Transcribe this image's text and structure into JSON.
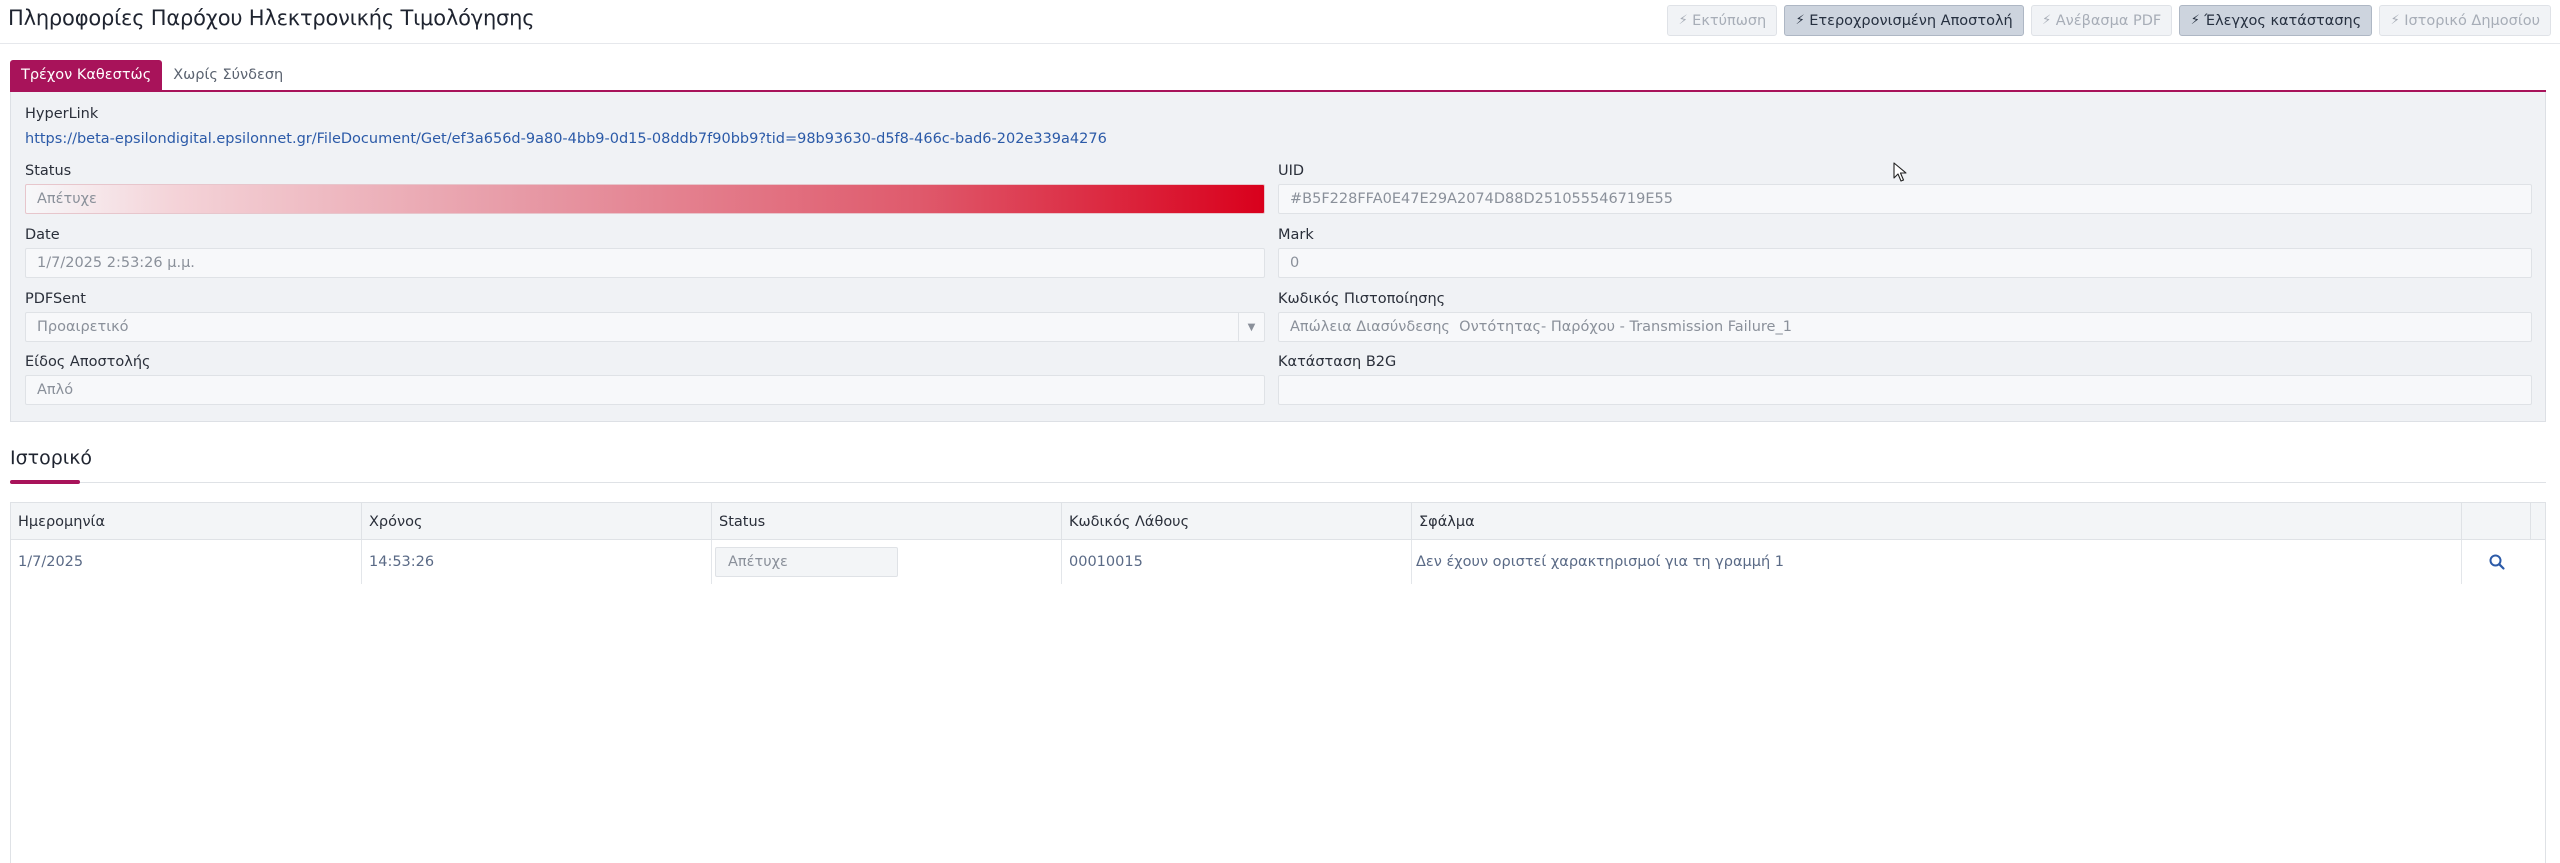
{
  "header": {
    "title": "Πληροφορίες Παρόχου Ηλεκτρονικής Τιμολόγησης",
    "buttons": [
      {
        "label": "Εκτύπωση",
        "icon": "bolt-icon",
        "active": false
      },
      {
        "label": "Ετεροχρονισμένη Αποστολή",
        "icon": "bolt-icon",
        "active": true
      },
      {
        "label": "Ανέβασμα PDF",
        "icon": "bolt-icon",
        "active": false
      },
      {
        "label": "Έλεγχος κατάστασης",
        "icon": "bolt-icon",
        "active": true
      },
      {
        "label": "Ιστορικό Δημοσίου",
        "icon": "bolt-icon",
        "active": false
      }
    ]
  },
  "tabs": [
    {
      "label": "Τρέχον Καθεστώς",
      "active": true
    },
    {
      "label": "Χωρίς Σύνδεση",
      "active": false
    }
  ],
  "info": {
    "hyperlink_label": "HyperLink",
    "hyperlink_url": "https://beta-epsilondigital.epsilonnet.gr/FileDocument/Get/ef3a656d-9a80-4bb9-0d15-08ddb7f90bb9?tid=98b93630-d5f8-466c-bad6-202e339a4276",
    "status_label": "Status",
    "status_value": "Απέτυχε",
    "status_color": "#d9001c",
    "uid_label": "UID",
    "uid_value": "#B5F228FFA0E47E29A2074D88D251055546719E55",
    "date_label": "Date",
    "date_value": "1/7/2025 2:53:26 μ.μ.",
    "mark_label": "Mark",
    "mark_value": "0",
    "pdfsent_label": "PDFSent",
    "pdfsent_value": "Προαιρετικό",
    "auth_code_label": "Κωδικός Πιστοποίησης",
    "auth_code_value": "Απώλεια Διασύνδεσης  Οντότητας- Παρόχου - Transmission Failure_1",
    "send_type_label": "Είδος Αποστολής",
    "send_type_value": "Απλό",
    "b2g_label": "Κατάσταση B2G",
    "b2g_value": ""
  },
  "history": {
    "title": "Ιστορικό",
    "columns": [
      "Ημερομηνία",
      "Χρόνος",
      "Status",
      "Κωδικός Λάθους",
      "Σφάλμα"
    ],
    "rows": [
      {
        "date": "1/7/2025",
        "time": "14:53:26",
        "status": "Απέτυχε",
        "error_code": "00010015",
        "error": "Δεν έχουν οριστεί χαρακτηρισμοί για τη γραμμή 1"
      }
    ]
  },
  "colors": {
    "accent": "#a8135a",
    "link": "#2b5aa8"
  }
}
